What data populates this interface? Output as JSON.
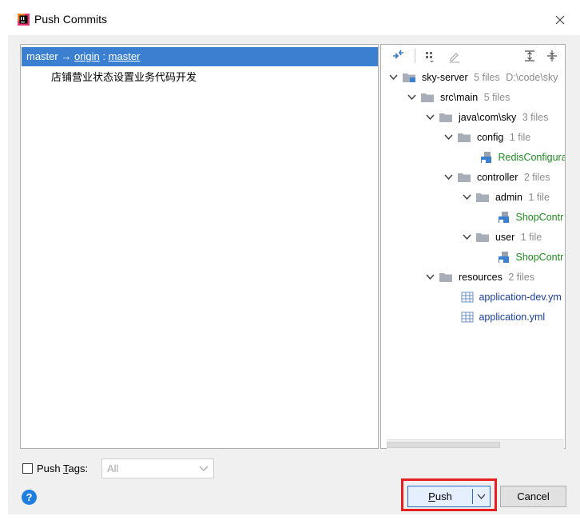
{
  "window": {
    "title": "Push Commits"
  },
  "branch": {
    "source": "master",
    "arrow": "→",
    "remote": "origin",
    "sep": ":",
    "target": "master"
  },
  "commits": [
    "店铺营业状态设置业务代码开发"
  ],
  "tree": [
    {
      "name": "sky-server",
      "count": "5 files",
      "extra": "D:\\code\\sky"
    },
    {
      "name": "src\\main",
      "count": "5 files"
    },
    {
      "name": "java\\com\\sky",
      "count": "3 files"
    },
    {
      "name": "config",
      "count": "1 file"
    },
    {
      "name": "RedisConfigura"
    },
    {
      "name": "controller",
      "count": "2 files"
    },
    {
      "name": "admin",
      "count": "1 file"
    },
    {
      "name": "ShopContr"
    },
    {
      "name": "user",
      "count": "1 file"
    },
    {
      "name": "ShopContr"
    },
    {
      "name": "resources",
      "count": "2 files"
    },
    {
      "name": "application-dev.ym"
    },
    {
      "name": "application.yml"
    }
  ],
  "push_tags": {
    "label_pre": "Push ",
    "label_mn": "T",
    "label_post": "ags:",
    "select_value": "All",
    "checked": false
  },
  "buttons": {
    "push_mn": "P",
    "push_rest": "ush",
    "cancel": "Cancel",
    "help": "?"
  },
  "colors": {
    "accent": "#3b7fd1",
    "highlight": "#e62020",
    "new_file": "#1f8a1f",
    "modified_file": "#1a3fa0"
  }
}
